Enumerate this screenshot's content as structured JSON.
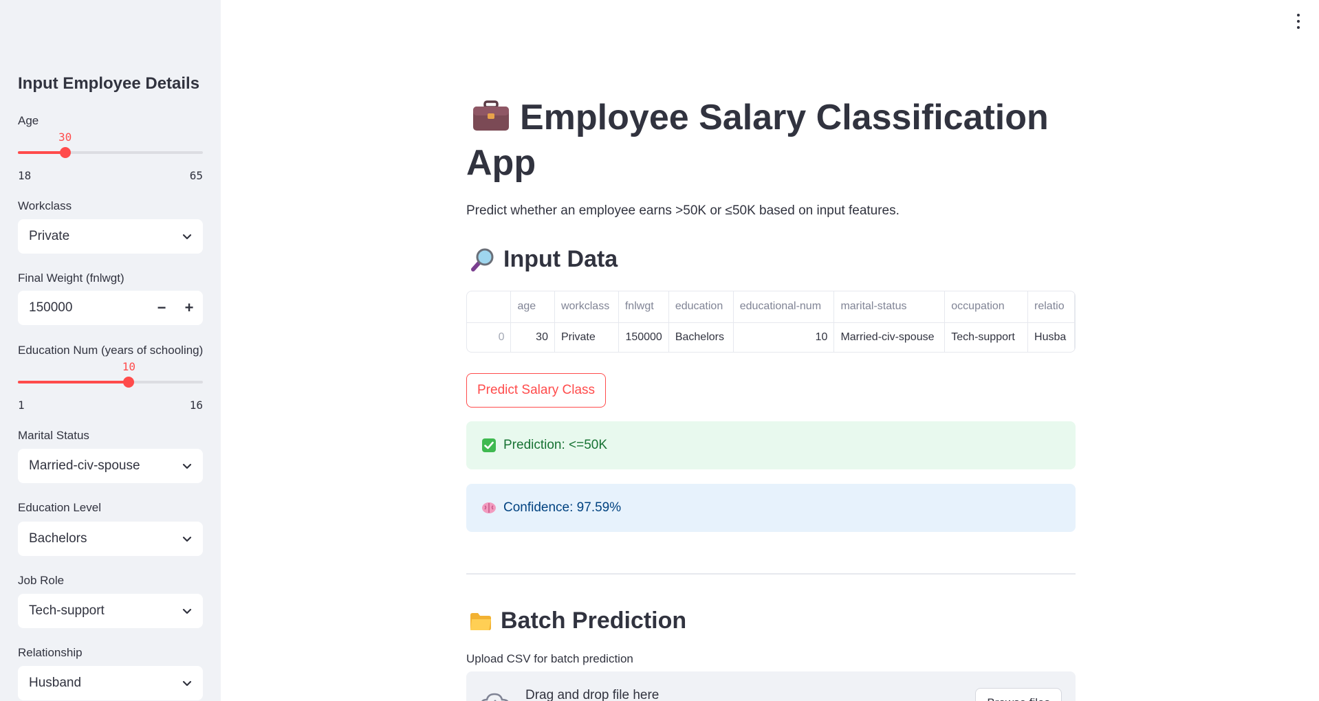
{
  "sidebar": {
    "title": "Input Employee Details",
    "age": {
      "label": "Age",
      "value": "30",
      "min": "18",
      "max": "65",
      "fraction": 0.255
    },
    "workclass": {
      "label": "Workclass",
      "value": "Private"
    },
    "fnlwgt": {
      "label": "Final Weight (fnlwgt)",
      "value": "150000",
      "minus": "−",
      "plus": "+"
    },
    "education_num": {
      "label": "Education Num (years of schooling)",
      "value": "10",
      "min": "1",
      "max": "16",
      "fraction": 0.6
    },
    "marital_status": {
      "label": "Marital Status",
      "value": "Married-civ-spouse"
    },
    "education_level": {
      "label": "Education Level",
      "value": "Bachelors"
    },
    "job_role": {
      "label": "Job Role",
      "value": "Tech-support"
    },
    "relationship": {
      "label": "Relationship",
      "value": "Husband"
    }
  },
  "main": {
    "title_line1": "Employee Salary Classification",
    "title_line2": "App",
    "subtitle": "Predict whether an employee earns >50K or ≤50K based on input features.",
    "input_heading": "Input Data",
    "table": {
      "columns": [
        "",
        "age",
        "workclass",
        "fnlwgt",
        "education",
        "educational-num",
        "marital-status",
        "occupation",
        "relatio"
      ],
      "row": [
        "0",
        "30",
        "Private",
        "150000",
        "Bachelors",
        "10",
        "Married-civ-spouse",
        "Tech-support",
        "Husba"
      ]
    },
    "predict_button": "Predict Salary Class",
    "prediction": "Prediction: <=50K",
    "confidence": "Confidence: 97.59%",
    "batch_heading": "Batch Prediction",
    "upload_label": "Upload CSV for batch prediction",
    "dropzone_text": "Drag and drop file here",
    "browse_button": "Browse files"
  },
  "colors": {
    "accent": "#ff4b4b",
    "success_bg": "#e8f9ee",
    "info_bg": "#e7f2fc"
  },
  "icons": [
    "briefcase-icon",
    "magnifier-icon",
    "check-icon",
    "brain-icon",
    "folder-icon",
    "cloud-upload-icon",
    "chevron-down-icon",
    "kebab-menu-icon"
  ]
}
